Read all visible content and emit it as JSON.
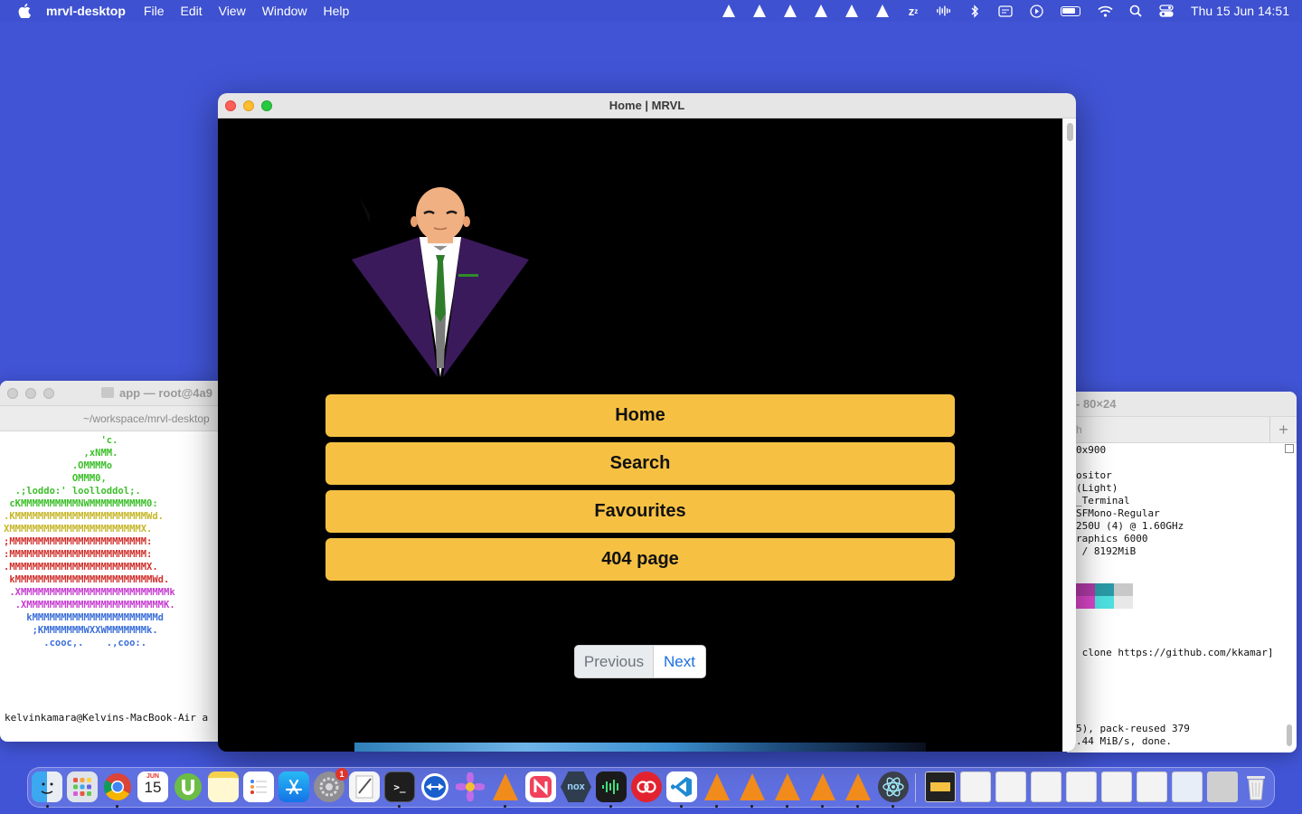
{
  "menubar": {
    "app_name": "mrvl-desktop",
    "menus": [
      "File",
      "Edit",
      "View",
      "Window",
      "Help"
    ],
    "clock": "Thu 15 Jun  14:51",
    "status_icons": [
      "vlc-icon",
      "vlc-icon",
      "vlc-icon",
      "vlc-icon",
      "vlc-icon",
      "vlc-icon",
      "sleep-icon",
      "audio-wave-icon",
      "bluetooth-icon",
      "input-icon",
      "play-icon",
      "battery-icon",
      "wifi-icon",
      "search-icon",
      "control-center-icon"
    ]
  },
  "terminal_left": {
    "title": "app — root@4a9",
    "path": "~/workspace/mrvl-desktop",
    "ascii_lines": [
      {
        "text": "                 'c.",
        "color": "#3cbf2b"
      },
      {
        "text": "              ,xNMM.",
        "color": "#3cbf2b"
      },
      {
        "text": "            .OMMMMo",
        "color": "#3cbf2b"
      },
      {
        "text": "            OMMM0,",
        "color": "#3cbf2b"
      },
      {
        "text": "  .;loddo:' loolloddol;.",
        "color": "#3cbf2b"
      },
      {
        "text": " cKMMMMMMMMMMNWMMMMMMMMMM0:",
        "color": "#3cbf2b"
      },
      {
        "text": ".KMMMMMMMMMMMMMMMMMMMMMMMWd.",
        "color": "#c6b72a"
      },
      {
        "text": "XMMMMMMMMMMMMMMMMMMMMMMMX.",
        "color": "#c6b72a"
      },
      {
        "text": ";MMMMMMMMMMMMMMMMMMMMMMMM:",
        "color": "#d0312d"
      },
      {
        "text": ":MMMMMMMMMMMMMMMMMMMMMMMM:",
        "color": "#d0312d"
      },
      {
        "text": ".MMMMMMMMMMMMMMMMMMMMMMMMX.",
        "color": "#d0312d"
      },
      {
        "text": " kMMMMMMMMMMMMMMMMMMMMMMMMWd.",
        "color": "#d0312d"
      },
      {
        "text": " .XMMMMMMMMMMMMMMMMMMMMMMMMMMk",
        "color": "#c63bd0"
      },
      {
        "text": "  .XMMMMMMMMMMMMMMMMMMMMMMMMK.",
        "color": "#c63bd0"
      },
      {
        "text": "    kMMMMMMMMMMMMMMMMMMMMMMd",
        "color": "#3b6fd8"
      },
      {
        "text": "     ;KMMMMMMMWXXWMMMMMMMk.",
        "color": "#3b6fd8"
      },
      {
        "text": "       .cooc,.    .,coo:.",
        "color": "#3b6fd8"
      }
    ],
    "prompt": "kelvinkamara@Kelvins-MacBook-Air a"
  },
  "terminal_right": {
    "title": "- 80×24",
    "tab": "h",
    "lines": [
      "0x900",
      "",
      "ositor",
      "(Light)",
      "_Terminal",
      "SFMono-Regular",
      "250U (4) @ 1.60GHz",
      "raphics 6000",
      " / 8192MiB",
      "",
      "",
      "",
      "",
      "",
      " clone https://github.com/kkamar]",
      "",
      "",
      "",
      "",
      "",
      "5), pack-reused 379",
      ".44 MiB/s, done."
    ],
    "swatch_top": [
      "#b13aa6",
      "#2a9aa6",
      "#c8c8c8"
    ],
    "swatch_bottom": [
      "#d946c9",
      "#4fe0e0",
      "#e8e8e8"
    ]
  },
  "main_window": {
    "title": "Home | MRVL",
    "nav": {
      "home": "Home",
      "search": "Search",
      "favourites": "Favourites",
      "not_found": "404 page"
    },
    "pagination": {
      "previous": "Previous",
      "next": "Next"
    }
  },
  "dock": {
    "calendar_month": "JUN",
    "calendar_day": "15",
    "settings_badge": "1",
    "apps": [
      "finder-icon",
      "launchpad-icon",
      "chrome-icon",
      "calendar-icon",
      "utorrent-icon",
      "notes-icon",
      "reminders-icon",
      "app-store-icon",
      "system-settings-icon",
      "textedit-icon",
      "terminal-icon",
      "teamviewer-icon",
      "flower-app-icon",
      "vlc-icon",
      "news-icon",
      "nox-icon",
      "audio-app-icon",
      "creative-cloud-icon",
      "vscode-icon",
      "vlc-icon",
      "vlc-icon",
      "vlc-icon",
      "vlc-icon",
      "vlc-icon",
      "electron-icon"
    ]
  },
  "colors": {
    "desktop": "#4154d6",
    "accent_button": "#f6c143",
    "link_blue": "#1b6ee0"
  }
}
